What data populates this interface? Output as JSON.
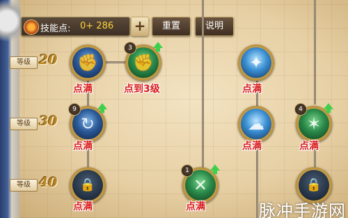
{
  "topbar": {
    "skill_points_label": "技能点:",
    "skill_points_value": "0+ 286",
    "plus_label": "+",
    "reset_label": "重置",
    "description_label": "说明"
  },
  "levels": [
    {
      "label": "等级",
      "value": "20"
    },
    {
      "label": "等级",
      "value": "30"
    },
    {
      "label": "等级",
      "value": "40"
    }
  ],
  "nodes": [
    {
      "icon": "fist-punch-icon",
      "badge": "",
      "upgrade": false,
      "status": "点满",
      "locked": false
    },
    {
      "icon": "raised-fist-icon",
      "badge": "3",
      "upgrade": true,
      "status": "点到3级",
      "locked": false
    },
    {
      "icon": "aura-figure-icon",
      "badge": "",
      "upgrade": false,
      "status": "点满",
      "locked": false
    },
    {
      "icon": "spin-kick-icon",
      "badge": "9",
      "upgrade": true,
      "status": "点满",
      "locked": false
    },
    {
      "icon": "cloud-burst-icon",
      "badge": "",
      "upgrade": false,
      "status": "点满",
      "locked": false
    },
    {
      "icon": "glowing-figure-icon",
      "badge": "4",
      "upgrade": true,
      "status": "点满",
      "locked": false
    },
    {
      "icon": "lock-icon",
      "badge": "",
      "upgrade": false,
      "status": "点满",
      "locked": true
    },
    {
      "icon": "crossed-arms-icon",
      "badge": "1",
      "upgrade": true,
      "status": "点满",
      "locked": false
    },
    {
      "icon": "lock-icon",
      "badge": "",
      "upgrade": false,
      "status": "",
      "locked": true
    }
  ],
  "watermark": "脉冲手游网",
  "colors": {
    "status_red": "#d81a1a",
    "points_yellow": "#ffd23a",
    "upgrade_green": "#3ed04b",
    "level_gold": "#b98525"
  }
}
